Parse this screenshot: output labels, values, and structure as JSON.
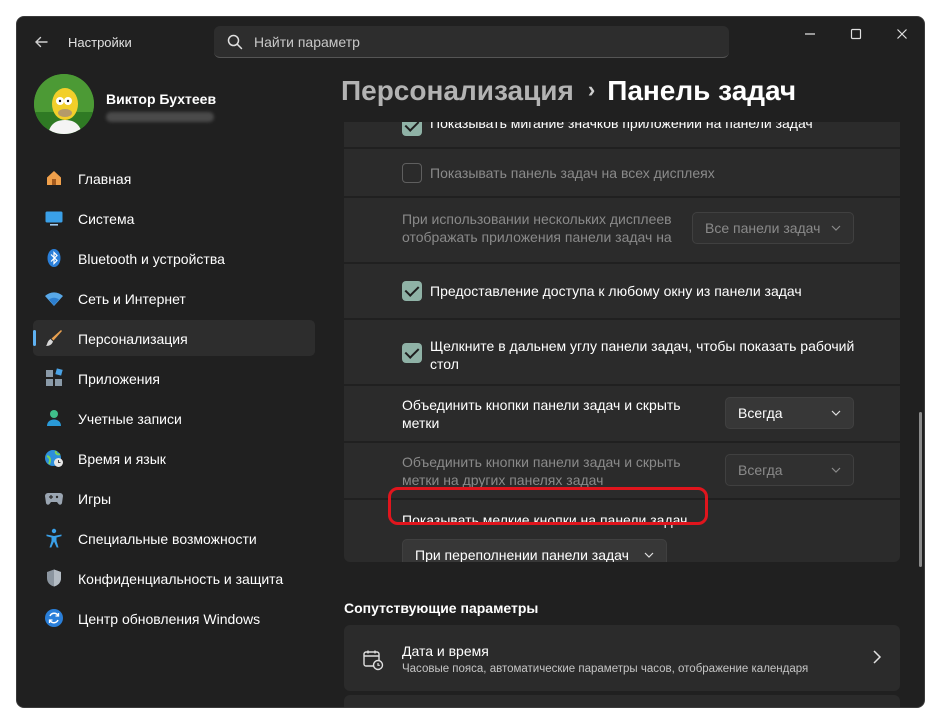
{
  "app": {
    "title": "Настройки"
  },
  "search": {
    "placeholder": "Найти параметр"
  },
  "user": {
    "name": "Виктор Бухтеев"
  },
  "sidebar": {
    "items": [
      {
        "label": "Главная",
        "icon": "home-icon"
      },
      {
        "label": "Система",
        "icon": "system-icon"
      },
      {
        "label": "Bluetooth и устройства",
        "icon": "bluetooth-icon"
      },
      {
        "label": "Сеть и Интернет",
        "icon": "wifi-icon"
      },
      {
        "label": "Персонализация",
        "icon": "brush-icon",
        "active": true
      },
      {
        "label": "Приложения",
        "icon": "apps-icon"
      },
      {
        "label": "Учетные записи",
        "icon": "account-icon"
      },
      {
        "label": "Время и язык",
        "icon": "globe-clock-icon"
      },
      {
        "label": "Игры",
        "icon": "gamepad-icon"
      },
      {
        "label": "Специальные возможности",
        "icon": "accessibility-icon"
      },
      {
        "label": "Конфиденциальность и защита",
        "icon": "shield-icon"
      },
      {
        "label": "Центр обновления Windows",
        "icon": "update-icon"
      }
    ]
  },
  "breadcrumb": {
    "parent": "Персонализация",
    "separator": "›",
    "current": "Панель задач"
  },
  "settings": {
    "top_cut": "Показывать мигание значков приложений на панели задач",
    "all_displays": "Показывать панель задач на всех дисплеях",
    "multi_display_label": "При использовании нескольких дисплеев отображать приложения панели задач на",
    "multi_display_value": "Все панели задач",
    "share_window": "Предоставление доступа к любому окну из панели задач",
    "far_corner": "Щелкните в дальнем углу панели задач, чтобы показать рабочий стол",
    "combine_label": "Объединить кнопки панели задач и скрыть метки",
    "combine_value": "Всегда",
    "combine_other_label": "Объединить кнопки панели задач и скрыть метки на других панелях задач",
    "combine_other_value": "Всегда",
    "small_buttons_label": "Показывать мелкие кнопки на панели задач",
    "small_buttons_value": "При переполнении панели задач"
  },
  "related": {
    "title": "Сопутствующие параметры",
    "items": [
      {
        "title": "Дата и время",
        "subtitle": "Часовые пояса, автоматические параметры часов, отображение календаря"
      }
    ]
  },
  "colors": {
    "accent": "#5fb2f2",
    "checkbox": "#8fb2a6",
    "highlight": "#e0151d",
    "background": "#202020",
    "card": "#2b2b2b"
  }
}
